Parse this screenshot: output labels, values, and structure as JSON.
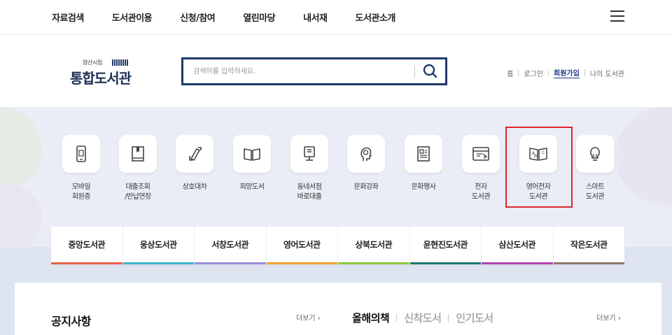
{
  "nav": {
    "items": [
      "자료검색",
      "도서관이용",
      "신청/참여",
      "열린마당",
      "내서재",
      "도서관소개"
    ]
  },
  "logo": {
    "small": "양산시립",
    "big": "통합도서관"
  },
  "search": {
    "placeholder": "검색어를 입력하세요."
  },
  "util": {
    "home": "홈",
    "login": "로그인",
    "join": "회원가입",
    "mylib": "나의 도서관"
  },
  "quick_menu": [
    {
      "label": "모바일\n회원증",
      "icon": "mobile-card-icon"
    },
    {
      "label": "대출조회\n/반납연장",
      "icon": "book-loan-icon"
    },
    {
      "label": "상호대차",
      "icon": "exchange-icon"
    },
    {
      "label": "희망도서",
      "icon": "open-book-icon"
    },
    {
      "label": "동네서점\n바로대출",
      "icon": "kiosk-icon"
    },
    {
      "label": "문화강좌",
      "icon": "head-lightbulb-icon"
    },
    {
      "label": "문화행사",
      "icon": "document-icon"
    },
    {
      "label": "전자\n도서관",
      "icon": "browser-window-icon"
    },
    {
      "label": "영어전자\n도서관",
      "icon": "abc-book-icon"
    },
    {
      "label": "스마트\n도서관",
      "icon": "lightbulb-icon"
    }
  ],
  "branches": [
    {
      "name": "중앙도서관",
      "color": "#e8604c"
    },
    {
      "name": "웅상도서관",
      "color": "#3bb5c8"
    },
    {
      "name": "서창도서관",
      "color": "#9b8fd8"
    },
    {
      "name": "영어도서관",
      "color": "#f0a030"
    },
    {
      "name": "상북도서관",
      "color": "#8dc63f"
    },
    {
      "name": "윤현진도서관",
      "color": "#1a7a6a"
    },
    {
      "name": "삼산도서관",
      "color": "#b040b0"
    },
    {
      "name": "작은도서관",
      "color": "#8a7a6a"
    }
  ],
  "panel": {
    "notice_title": "공지사항",
    "more": "더보기",
    "tabs": [
      "올해의책",
      "신착도서",
      "인기도서"
    ],
    "more2": "더보기"
  },
  "colors": {
    "brand_navy": "#1f3a6b",
    "highlight_red": "#e0262d",
    "band_bg": "#eaedf6"
  }
}
